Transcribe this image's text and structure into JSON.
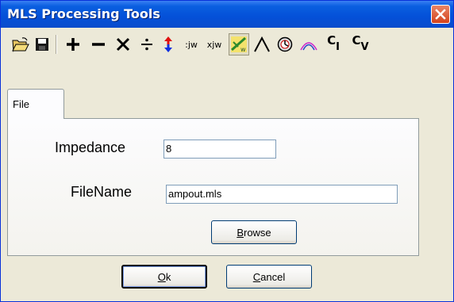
{
  "window": {
    "title": "MLS Processing Tools"
  },
  "toolbar": {
    "icons": [
      "open-folder-icon",
      "save-icon",
      "add-icon",
      "subtract-icon",
      "multiply-icon",
      "divide-icon",
      "swap-vertical-icon",
      "div-jw-icon",
      "mul-jw-icon",
      "graph-icon",
      "window-arch-icon",
      "clock-icon",
      "arch-curves-icon",
      "ci-icon",
      "cv-icon"
    ],
    "div_jw": ":jw",
    "mul_jw": "xjw",
    "ci_sub": "I",
    "cv_sub": "V",
    "c": "C"
  },
  "tabs": [
    {
      "label": "File"
    }
  ],
  "form": {
    "impedance_label": "Impedance",
    "impedance_value": "8",
    "filename_label": "FileName",
    "filename_value": "ampout.mls",
    "browse_key": "B",
    "browse_rest": "rowse"
  },
  "footer": {
    "ok_key": "O",
    "ok_rest": "k",
    "cancel_key": "C",
    "cancel_rest": "ancel"
  }
}
